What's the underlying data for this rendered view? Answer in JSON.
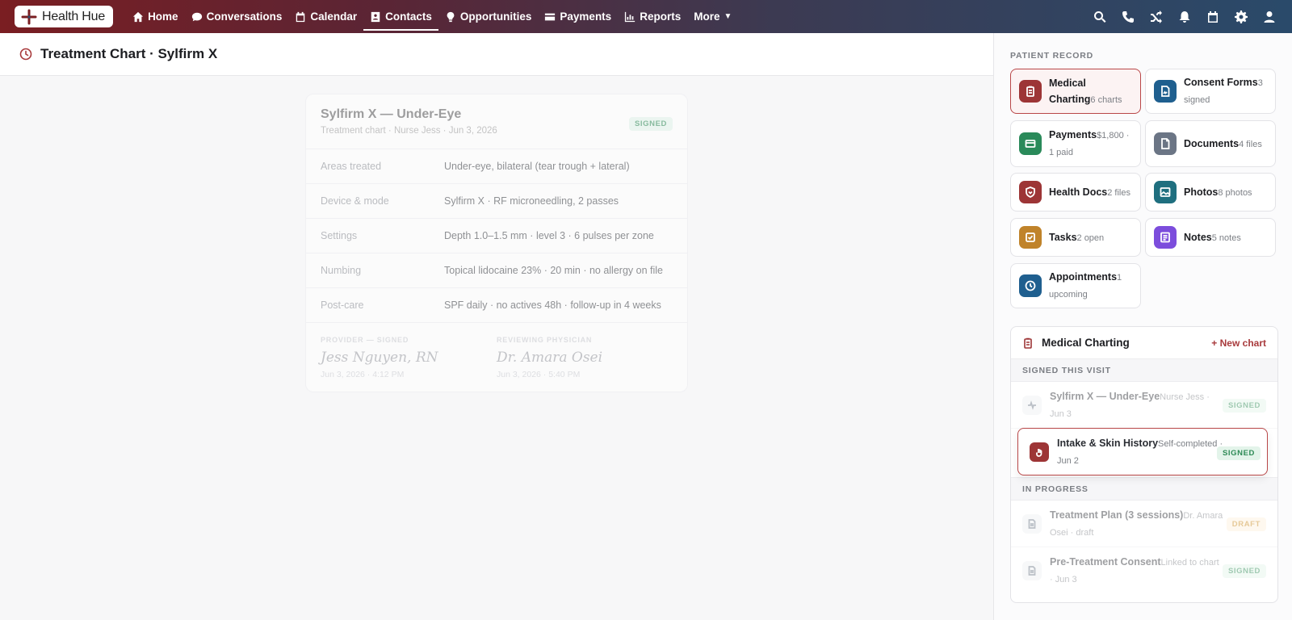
{
  "app": {
    "logo_text": "Health Hue"
  },
  "nav": {
    "items": [
      {
        "label": "Home",
        "icon": "home-icon"
      },
      {
        "label": "Conversations",
        "icon": "chat-icon"
      },
      {
        "label": "Calendar",
        "icon": "calendar-icon"
      },
      {
        "label": "Contacts",
        "icon": "contacts-icon",
        "active": true
      },
      {
        "label": "Opportunities",
        "icon": "lightbulb-icon"
      },
      {
        "label": "Payments",
        "icon": "card-icon"
      },
      {
        "label": "Reports",
        "icon": "chart-icon"
      },
      {
        "label": "More",
        "icon": "caret-down-icon"
      }
    ],
    "right_icons": [
      "search-icon",
      "phone-icon",
      "shuffle-icon",
      "bell-icon",
      "calendar-icon",
      "gear-icon",
      "user-icon"
    ]
  },
  "page": {
    "title": "Treatment Chart · Sylfirm X"
  },
  "chart": {
    "title": "Sylfirm X — Under-Eye",
    "subtitle": "Treatment chart · Nurse Jess · Jun 3, 2026",
    "status": "SIGNED",
    "rows": [
      {
        "label": "Areas treated",
        "value": "Under-eye, bilateral (tear trough + lateral)"
      },
      {
        "label": "Device & mode",
        "value": "Sylfirm X · RF microneedling, 2 passes"
      },
      {
        "label": "Settings",
        "value": "Depth 1.0–1.5 mm · level 3 · 6 pulses per zone"
      },
      {
        "label": "Numbing",
        "value": "Topical lidocaine 23% · 20 min · no allergy on file"
      },
      {
        "label": "Post-care",
        "value": "SPF daily · no actives 48h · follow-up in 4 weeks"
      }
    ],
    "provider": {
      "caption": "PROVIDER — SIGNED",
      "name": "Jess Nguyen, RN",
      "date": "Jun 3, 2026 · 4:12 PM"
    },
    "reviewer": {
      "caption": "REVIEWING PHYSICIAN",
      "name": "Dr. Amara Osei",
      "date": "Jun 3, 2026 · 5:40 PM"
    }
  },
  "record": {
    "caption": "PATIENT RECORD",
    "tiles": [
      {
        "name": "Medical Charting",
        "meta": "6 charts",
        "color": "#9d3536",
        "icon": "clipboard-icon"
      },
      {
        "name": "Consent Forms",
        "meta": "3 signed",
        "color": "#1f5f8f",
        "icon": "signed-doc-icon"
      },
      {
        "name": "Payments",
        "meta": "$1,800 · 1 paid",
        "color": "#2a8a5a",
        "icon": "card-icon"
      },
      {
        "name": "Documents",
        "meta": "4 files",
        "color": "#6b7585",
        "icon": "file-icon"
      },
      {
        "name": "Health Docs",
        "meta": "2 files",
        "color": "#9d3536",
        "icon": "heart-shield-icon"
      },
      {
        "name": "Photos",
        "meta": "8 photos",
        "color": "#1f6f7f",
        "icon": "image-icon"
      },
      {
        "name": "Tasks",
        "meta": "2 open",
        "color": "#c0832a",
        "icon": "checkbox-icon"
      },
      {
        "name": "Notes",
        "meta": "5 notes",
        "color": "#7c4ddc",
        "icon": "note-icon"
      },
      {
        "name": "Appointments",
        "meta": "1 upcoming",
        "color": "#1f5f8f",
        "icon": "clock-icon"
      }
    ]
  },
  "charting": {
    "title": "Medical Charting",
    "new_label": "+ New chart",
    "section_signed": "SIGNED THIS VISIT",
    "section_progress": "IN PROGRESS",
    "items": [
      {
        "name": "Sylfirm X — Under-Eye",
        "meta": "Nurse Jess · Jun 3",
        "status": "SIGNED"
      },
      {
        "name": "Intake & Skin History",
        "meta": "Self-completed · Jun 2",
        "status": "SIGNED"
      },
      {
        "name": "Treatment Plan (3 sessions)",
        "meta": "Dr. Amara Osei · draft",
        "status": "DRAFT"
      },
      {
        "name": "Pre-Treatment Consent",
        "meta": "Linked to chart · Jun 3",
        "status": "SIGNED"
      }
    ]
  }
}
